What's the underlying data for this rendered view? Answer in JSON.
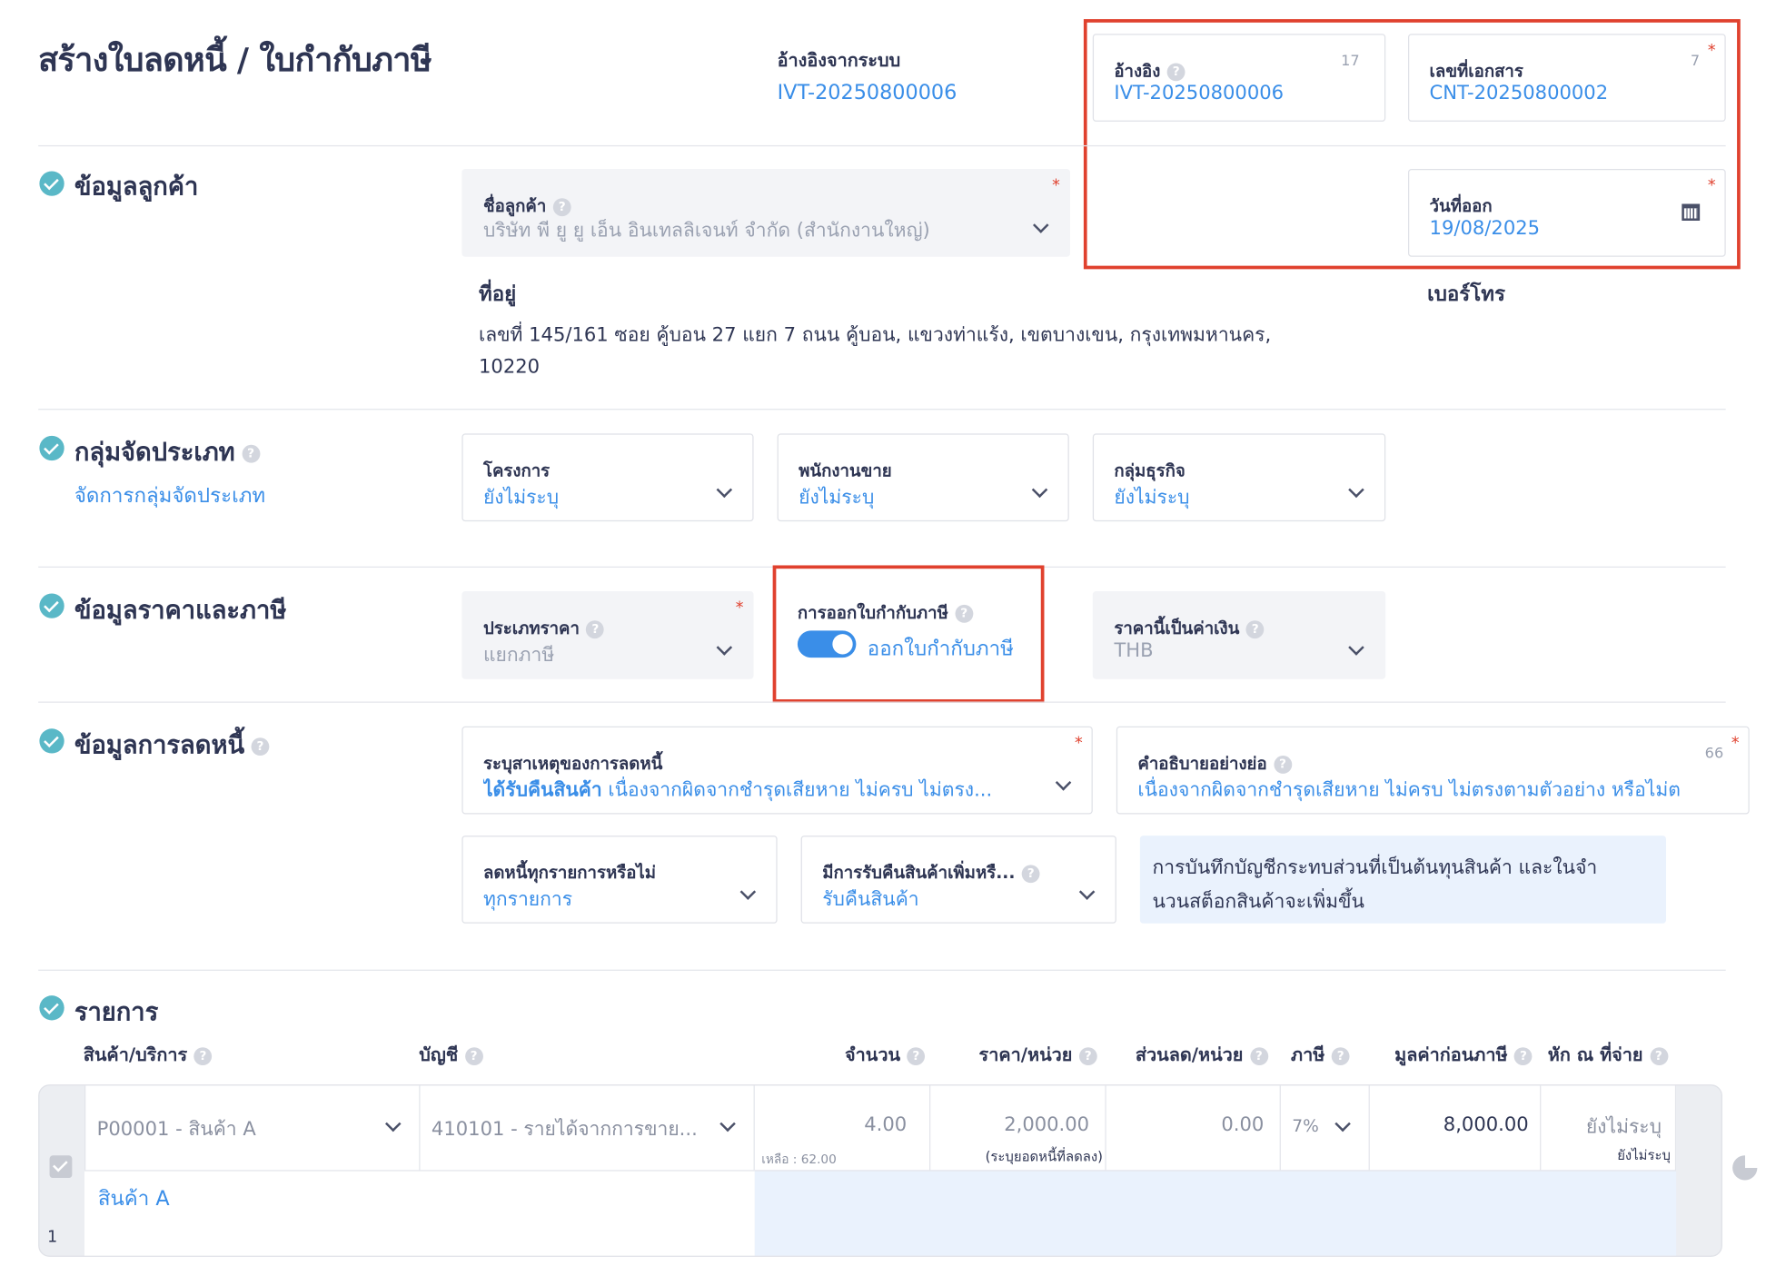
{
  "header": {
    "title": "สร้างใบลดหนี้ / ใบกำกับภาษี",
    "system_ref_label": "อ้างอิงจากระบบ",
    "system_ref_value": "IVT-20250800006"
  },
  "doc_fields": {
    "reference": {
      "label": "อ้างอิง",
      "value": "IVT-20250800006",
      "count": "17"
    },
    "doc_number": {
      "label": "เลขที่เอกสาร",
      "value": "CNT-20250800002",
      "count": "7"
    },
    "issue_date": {
      "label": "วันที่ออก",
      "value": "19/08/2025"
    }
  },
  "customer": {
    "section_title": "ข้อมูลลูกค้า",
    "name_label": "ชื่อลูกค้า",
    "name_value": "บริษัท พี ยู ยู เอ็น อินเทลลิเจนท์ จำกัด (สำนักงานใหญ่)",
    "address_label": "ที่อยู่",
    "address_line1": "เลขที่ 145/161 ซอย คู้บอน 27 แยก 7 ถนน คู้บอน, แขวงท่าแร้ง, เขตบางเขน, กรุงเทพมหานคร,",
    "address_line2": "10220",
    "phone_label": "เบอร์โทร"
  },
  "classification": {
    "section_title": "กลุ่มจัดประเภท",
    "manage_link": "จัดการกลุ่มจัดประเภท",
    "project_label": "โครงการ",
    "project_value": "ยังไม่ระบุ",
    "sales_label": "พนักงานขาย",
    "sales_value": "ยังไม่ระบุ",
    "group_label": "กลุ่มธุรกิจ",
    "group_value": "ยังไม่ระบุ"
  },
  "pricing": {
    "section_title": "ข้อมูลราคาและภาษี",
    "price_type_label": "ประเภทราคา",
    "price_type_value": "แยกภาษี",
    "tax_invoice_label": "การออกใบกำกับภาษี",
    "tax_invoice_toggle": "ออกใบกำกับภาษี",
    "currency_label": "ราคานี้เป็นค่าเงิน",
    "currency_value": "THB"
  },
  "credit": {
    "section_title": "ข้อมูลการลดหนี้",
    "reason_label": "ระบุสาเหตุของการลดหนี้",
    "reason_bold": "ได้รับคืนสินค้า",
    "reason_rest": "เนื่องจากผิดจากชำรุดเสียหาย ไม่ครบ ไม่ตรง...",
    "desc_label": "คำอธิบายอย่างย่อ",
    "desc_count": "66",
    "desc_value": "เนื่องจากผิดจากชำรุดเสียหาย ไม่ครบ ไม่ตรงตามตัวอย่าง หรือไม่ต",
    "all_items_label": "ลดหนี้ทุกรายการหรือไม่",
    "all_items_value": "ทุกรายการ",
    "return_label": "มีการรับคืนสินค้าเพิ่มหรื...",
    "return_value": "รับคืนสินค้า",
    "note_line1": "การบันทึกบัญชีกระทบส่วนที่เป็นต้นทุนสินค้า และในจำ",
    "note_line2": "นวนสต็อกสินค้าจะเพิ่มขึ้น"
  },
  "items": {
    "section_title": "รายการ",
    "columns": {
      "product": "สินค้า/บริการ",
      "account": "บัญชี",
      "qty": "จำนวน",
      "unit_price": "ราคา/หน่วย",
      "discount": "ส่วนลด/หน่วย",
      "tax": "ภาษี",
      "pretax": "มูลค่าก่อนภาษี",
      "withholding": "หัก ณ ที่จ่าย"
    },
    "row": {
      "product": "P00001 - สินค้า A",
      "account": "410101 - รายได้จากการขาย...",
      "qty": "4.00",
      "remaining": "เหลือ : 62.00",
      "unit_price": "2,000.00",
      "unit_price_note": "(ระบุยอดหนี้ที่ลดลง)",
      "discount": "0.00",
      "tax": "7%",
      "pretax": "8,000.00",
      "withholding": "ยังไม่ระบุ",
      "withholding_sub": "ยังไม่ระบุ",
      "description": "สินค้า A",
      "index": "1"
    }
  },
  "colors": {
    "accent": "#3a8ee8",
    "highlight": "#e0412e",
    "check": "#5ab8c7"
  }
}
